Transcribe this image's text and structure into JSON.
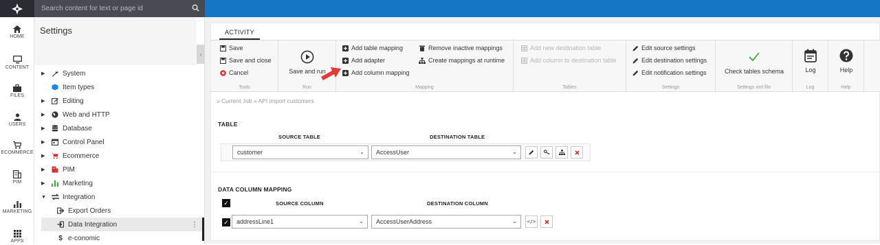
{
  "search": {
    "placeholder": "Search content for text or page id"
  },
  "leftnav": {
    "items": [
      {
        "label": "HOME",
        "icon": "home-icon"
      },
      {
        "label": "CONTENT",
        "icon": "monitor-icon"
      },
      {
        "label": "FILES",
        "icon": "briefcase-icon"
      },
      {
        "label": "USERS",
        "icon": "user-icon"
      },
      {
        "label": "ECOMMERCE",
        "icon": "cart-icon"
      },
      {
        "label": "PIM",
        "icon": "building-icon"
      },
      {
        "label": "MARKETING",
        "icon": "bar-chart-icon"
      },
      {
        "label": "APPS",
        "icon": "grid-icon"
      }
    ]
  },
  "tree": {
    "title": "Settings",
    "items": [
      {
        "label": "System",
        "icon": "wrench-icon"
      },
      {
        "label": "Item types",
        "icon": "cube-icon"
      },
      {
        "label": "Editing",
        "icon": "edit-icon"
      },
      {
        "label": "Web and HTTP",
        "icon": "globe-icon"
      },
      {
        "label": "Database",
        "icon": "database-icon"
      },
      {
        "label": "Control Panel",
        "icon": "calendar-icon"
      },
      {
        "label": "Ecommerce",
        "icon": "cart-icon"
      },
      {
        "label": "PIM",
        "icon": "pim-icon"
      },
      {
        "label": "Marketing",
        "icon": "bar-chart-icon"
      },
      {
        "label": "Integration",
        "icon": "exchange-icon"
      },
      {
        "label": "Export Orders",
        "icon": "export-icon"
      },
      {
        "label": "Data Integration",
        "icon": "import-icon"
      },
      {
        "label": "e-conomic",
        "icon": "dollar-icon"
      }
    ]
  },
  "tabs": {
    "activity": "ACTIVITY"
  },
  "ribbon": {
    "tools": {
      "save": "Save",
      "save_close": "Save and close",
      "cancel": "Cancel",
      "label": "Tools"
    },
    "run": {
      "save_run": "Save and run",
      "label": "Run"
    },
    "mapping": {
      "add_table": "Add table mapping",
      "add_adapter": "Add adapter",
      "add_column": "Add column mapping",
      "remove_inactive": "Remove inactive mappings",
      "create_runtime": "Create mappings at runtime",
      "label": "Mapping"
    },
    "tables": {
      "add_dest_table": "Add new destination table",
      "add_col_dest": "Add column to destination table",
      "label": "Tables"
    },
    "settings": {
      "edit_source": "Edit source settings",
      "edit_dest": "Edit destination settings",
      "edit_notif": "Edit notification settings",
      "label": "Settings"
    },
    "xml": {
      "check": "Check tables schema",
      "label": "Settings xml file"
    },
    "log": {
      "btn": "Log",
      "label": "Log"
    },
    "help": {
      "btn": "Help",
      "label": "Help"
    }
  },
  "breadcrumb": "» Current Job » API import customers",
  "table_section": {
    "title": "TABLE",
    "source_header": "SOURCE TABLE",
    "dest_header": "DESTINATION TABLE",
    "source_value": "customer",
    "dest_value": "AccessUser"
  },
  "column_section": {
    "title": "DATA COLUMN MAPPING",
    "source_header": "SOURCE COLUMN",
    "dest_header": "DESTINATION COLUMN",
    "source_value": "addressLine1",
    "dest_value": "AccessUserAddress"
  },
  "colors": {
    "topbar": "#1476c4",
    "accent_red": "#d32f2f",
    "check_green": "#4caf50",
    "arrow_red": "#e53935"
  }
}
